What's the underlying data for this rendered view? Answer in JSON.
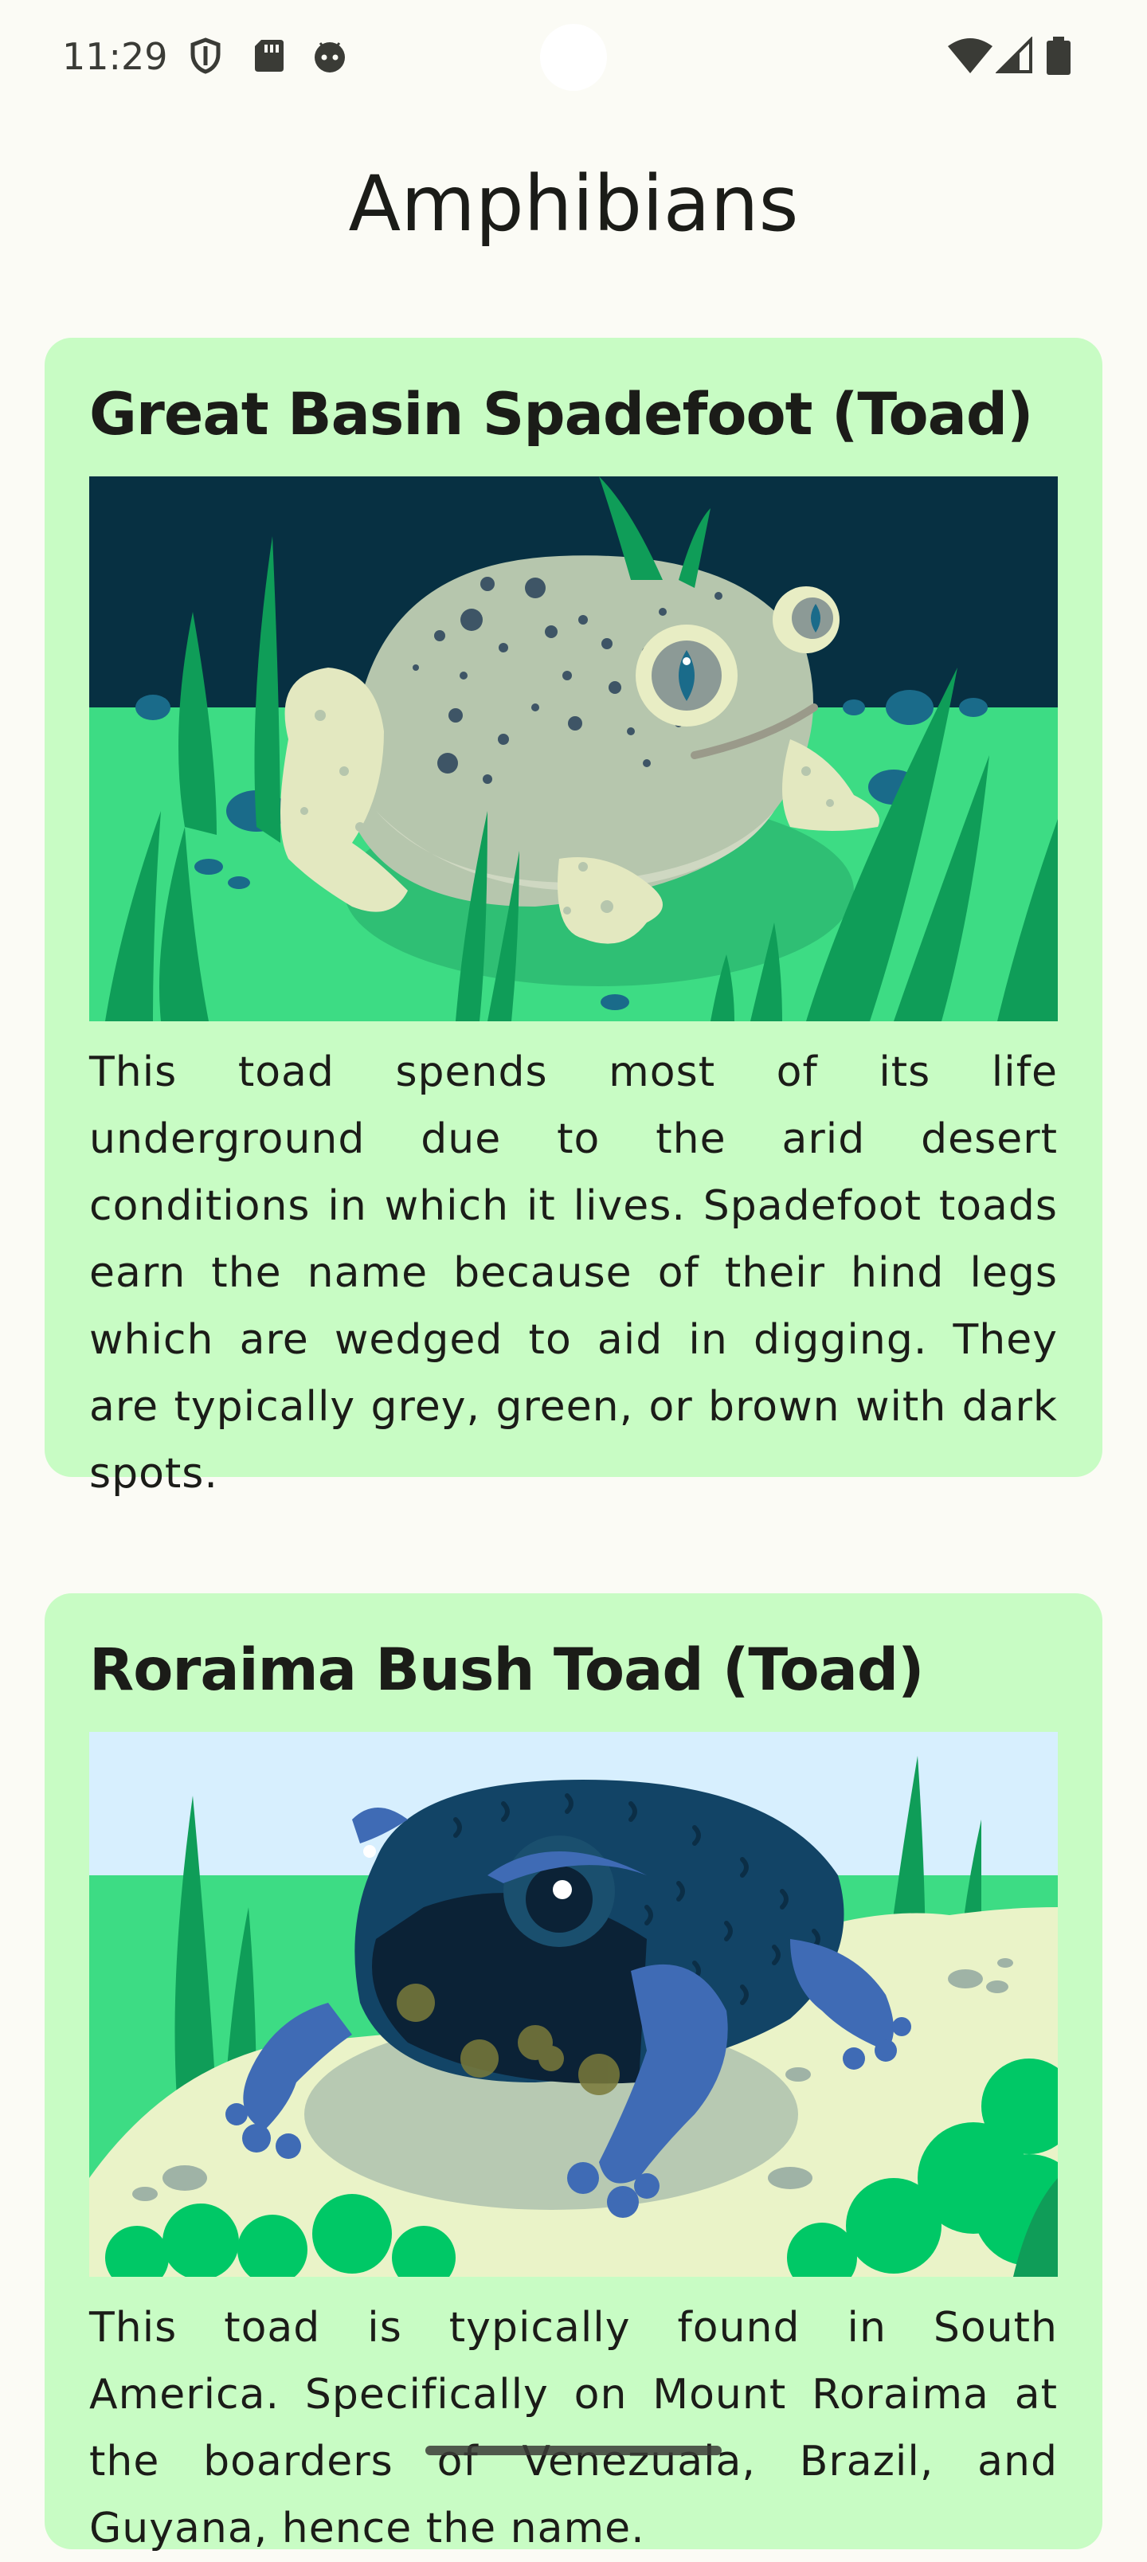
{
  "status_bar": {
    "time": "11:29",
    "left_icons": [
      "shield-icon",
      "sd-card-icon",
      "android-face-icon"
    ],
    "right_icons": [
      "wifi-icon",
      "cellular-signal-icon",
      "battery-icon"
    ]
  },
  "page": {
    "title": "Amphibians"
  },
  "amphibians": [
    {
      "name": "Great Basin Spadefoot (Toad)",
      "image_icon": "spadefoot-toad-illustration",
      "description": "This toad spends most of its life underground due to the arid desert conditions in which it lives. Spadefoot toads earn the name because of their hind legs which are wedged to aid in digging. They are typically grey, green, or brown with dark spots."
    },
    {
      "name": "Roraima Bush Toad (Toad)",
      "image_icon": "bush-toad-illustration",
      "description": "This toad is typically found in South America. Specifically on Mount Roraima at the boarders of Venezuala, Brazil, and Guyana, hence the name."
    }
  ],
  "colors": {
    "background": "#fbfbf5",
    "card": "#c8fcc4",
    "text": "#1b1c18"
  }
}
